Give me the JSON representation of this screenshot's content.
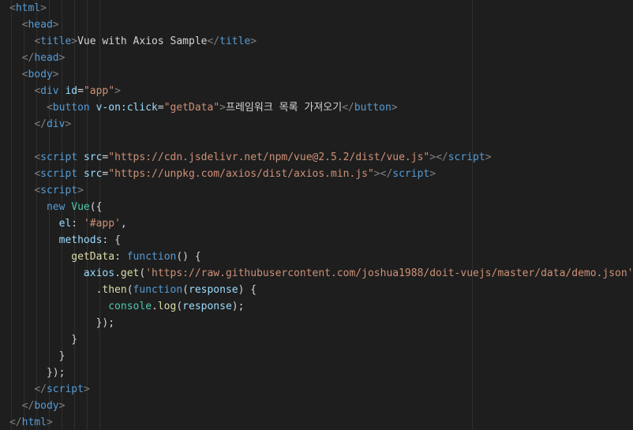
{
  "editor": {
    "language": "html",
    "theme_background": "#1e1e1e",
    "colors": {
      "tag": "#569cd6",
      "bracket": "#808080",
      "attribute": "#9cdcfe",
      "string": "#ce9178",
      "keyword": "#569cd6",
      "function": "#dcdcaa",
      "text": "#d4d4d4",
      "type": "#4ec9b0"
    },
    "lines": [
      [
        [
          "",
          "<",
          "br"
        ],
        [
          "",
          "html",
          "tag"
        ],
        [
          "",
          ">",
          "br"
        ]
      ],
      [
        [
          "  ",
          "<",
          "br"
        ],
        [
          "",
          "head",
          "tag"
        ],
        [
          "",
          ">",
          "br"
        ]
      ],
      [
        [
          "    ",
          "<",
          "br"
        ],
        [
          "",
          "title",
          "tag"
        ],
        [
          "",
          ">",
          "br"
        ],
        [
          "",
          "Vue with Axios Sample",
          "txt"
        ],
        [
          "",
          "</",
          "br"
        ],
        [
          "",
          "title",
          "tag"
        ],
        [
          "",
          ">",
          "br"
        ]
      ],
      [
        [
          "  ",
          "</",
          "br"
        ],
        [
          "",
          "head",
          "tag"
        ],
        [
          "",
          ">",
          "br"
        ]
      ],
      [
        [
          "  ",
          "<",
          "br"
        ],
        [
          "",
          "body",
          "tag"
        ],
        [
          "",
          ">",
          "br"
        ]
      ],
      [
        [
          "    ",
          "<",
          "br"
        ],
        [
          "",
          "div",
          "tag"
        ],
        [
          " ",
          "id",
          "attr"
        ],
        [
          "",
          "=",
          "pun"
        ],
        [
          "",
          "\"app\"",
          "str"
        ],
        [
          "",
          ">",
          "br"
        ]
      ],
      [
        [
          "      ",
          "<",
          "br"
        ],
        [
          "",
          "button",
          "tag"
        ],
        [
          " ",
          "v-on:click",
          "attr"
        ],
        [
          "",
          "=",
          "pun"
        ],
        [
          "",
          "\"getData\"",
          "str"
        ],
        [
          "",
          ">",
          "br"
        ],
        [
          "",
          "프레임워크 목록 가져오기",
          "txt"
        ],
        [
          "",
          "</",
          "br"
        ],
        [
          "",
          "button",
          "tag"
        ],
        [
          "",
          ">",
          "br"
        ]
      ],
      [
        [
          "    ",
          "</",
          "br"
        ],
        [
          "",
          "div",
          "tag"
        ],
        [
          "",
          ">",
          "br"
        ]
      ],
      [],
      [
        [
          "    ",
          "<",
          "br"
        ],
        [
          "",
          "script",
          "tag"
        ],
        [
          " ",
          "src",
          "attr"
        ],
        [
          "",
          "=",
          "pun"
        ],
        [
          "",
          "\"https://cdn.jsdelivr.net/npm/vue@2.5.2/dist/vue.js\"",
          "str"
        ],
        [
          "",
          "></",
          "br"
        ],
        [
          "",
          "script",
          "tag"
        ],
        [
          "",
          ">",
          "br"
        ]
      ],
      [
        [
          "    ",
          "<",
          "br"
        ],
        [
          "",
          "script",
          "tag"
        ],
        [
          " ",
          "src",
          "attr"
        ],
        [
          "",
          "=",
          "pun"
        ],
        [
          "",
          "\"https://unpkg.com/axios/dist/axios.min.js\"",
          "str"
        ],
        [
          "",
          "></",
          "br"
        ],
        [
          "",
          "script",
          "tag"
        ],
        [
          "",
          ">",
          "br"
        ]
      ],
      [
        [
          "    ",
          "<",
          "br"
        ],
        [
          "",
          "script",
          "tag"
        ],
        [
          "",
          ">",
          "br"
        ]
      ],
      [
        [
          "      ",
          "new",
          "kw"
        ],
        [
          " ",
          "Vue",
          "type"
        ],
        [
          "",
          "({",
          "pun"
        ]
      ],
      [
        [
          "        ",
          "el",
          "prop"
        ],
        [
          "",
          ": ",
          "pun"
        ],
        [
          "",
          "'#app'",
          "str"
        ],
        [
          "",
          ",",
          "pun"
        ]
      ],
      [
        [
          "        ",
          "methods",
          "prop"
        ],
        [
          "",
          ": {",
          "pun"
        ]
      ],
      [
        [
          "          ",
          "getData",
          "fn"
        ],
        [
          "",
          ": ",
          "pun"
        ],
        [
          "",
          "function",
          "kw"
        ],
        [
          "",
          "() {",
          "pun"
        ]
      ],
      [
        [
          "            ",
          "axios",
          "prop"
        ],
        [
          "",
          ".",
          "pun"
        ],
        [
          "",
          "get",
          "fn"
        ],
        [
          "",
          "(",
          "pun"
        ],
        [
          "",
          "'https://raw.githubusercontent.com/joshua1988/doit-vuejs/master/data/demo.json'",
          "str"
        ],
        [
          "",
          ")",
          "pun"
        ]
      ],
      [
        [
          "              ",
          ".",
          "pun"
        ],
        [
          "",
          "then",
          "fn"
        ],
        [
          "",
          "(",
          "pun"
        ],
        [
          "",
          "function",
          "kw"
        ],
        [
          "",
          "(",
          "pun"
        ],
        [
          "",
          "response",
          "prop"
        ],
        [
          "",
          ") {",
          "pun"
        ]
      ],
      [
        [
          "                ",
          "console",
          "type"
        ],
        [
          "",
          ".",
          "pun"
        ],
        [
          "",
          "log",
          "fn"
        ],
        [
          "",
          "(",
          "pun"
        ],
        [
          "",
          "response",
          "prop"
        ],
        [
          "",
          ");",
          "pun"
        ]
      ],
      [
        [
          "              ",
          "});",
          "pun"
        ]
      ],
      [
        [
          "          ",
          "}",
          "pun"
        ]
      ],
      [
        [
          "        ",
          "}",
          "pun"
        ]
      ],
      [
        [
          "      ",
          "});",
          "pun"
        ]
      ],
      [
        [
          "    ",
          "</",
          "br"
        ],
        [
          "",
          "script",
          "tag"
        ],
        [
          "",
          ">",
          "br"
        ]
      ],
      [
        [
          "  ",
          "</",
          "br"
        ],
        [
          "",
          "body",
          "tag"
        ],
        [
          "",
          ">",
          "br"
        ]
      ],
      [
        [
          "",
          "</",
          "br"
        ],
        [
          "",
          "html",
          "tag"
        ],
        [
          "",
          ">",
          "br"
        ]
      ]
    ]
  }
}
